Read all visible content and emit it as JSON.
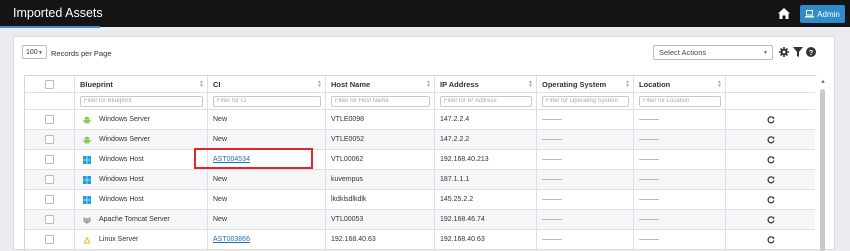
{
  "header": {
    "title": "Imported Assets",
    "admin_label": "Admin"
  },
  "toolbar": {
    "page_size": "100",
    "records_label": "Records per Page",
    "actions_placeholder": "Select Actions"
  },
  "table": {
    "columns": [
      "Blueprint",
      "CI",
      "Host Name",
      "IP Address",
      "Operating System",
      "Location"
    ],
    "filters": [
      "Filter for Blueprint",
      "Filter for CI",
      "Filter for Host Name",
      "Filter for IP Address",
      "Filter for Operating System",
      "Filter for Location"
    ],
    "rows": [
      {
        "icon": "android-icon",
        "blueprint": "Windows Server",
        "ci": "New",
        "ci_link": false,
        "host": "VTLE0098",
        "ip": "147.2.2.4",
        "os": "———",
        "location": "———"
      },
      {
        "icon": "android-icon",
        "blueprint": "Windows Server",
        "ci": "New",
        "ci_link": false,
        "host": "VTLE0052",
        "ip": "147.2.2.2",
        "os": "———",
        "location": "———"
      },
      {
        "icon": "windows-icon",
        "blueprint": "Windows Host",
        "ci": "AST004534",
        "ci_link": true,
        "host": "VTL00062",
        "ip": "192.168.40.213",
        "os": "———",
        "location": "———"
      },
      {
        "icon": "windows-icon",
        "blueprint": "Windows Host",
        "ci": "New",
        "ci_link": false,
        "host": "kuvempus",
        "ip": "187.1.1.1",
        "os": "———",
        "location": "———"
      },
      {
        "icon": "windows-icon",
        "blueprint": "Windows Host",
        "ci": "New",
        "ci_link": false,
        "host": "lkdklsdlkdlk",
        "ip": "145.25.2.2",
        "os": "———",
        "location": "———"
      },
      {
        "icon": "tomcat-icon",
        "blueprint": "Apache Tomcat Server",
        "ci": "New",
        "ci_link": false,
        "host": "VTL00053",
        "ip": "192.168.46.74",
        "os": "———",
        "location": "———"
      },
      {
        "icon": "linux-icon",
        "blueprint": "Linux Server",
        "ci": "AST003866",
        "ci_link": true,
        "host": "192.168.40.63",
        "ip": "192.168.40.63",
        "os": "———",
        "location": "———"
      }
    ]
  },
  "colors": {
    "topbar": "#141414",
    "accent": "#2f8cc9",
    "link": "#1f6fb2",
    "highlight": "#e0262b"
  }
}
